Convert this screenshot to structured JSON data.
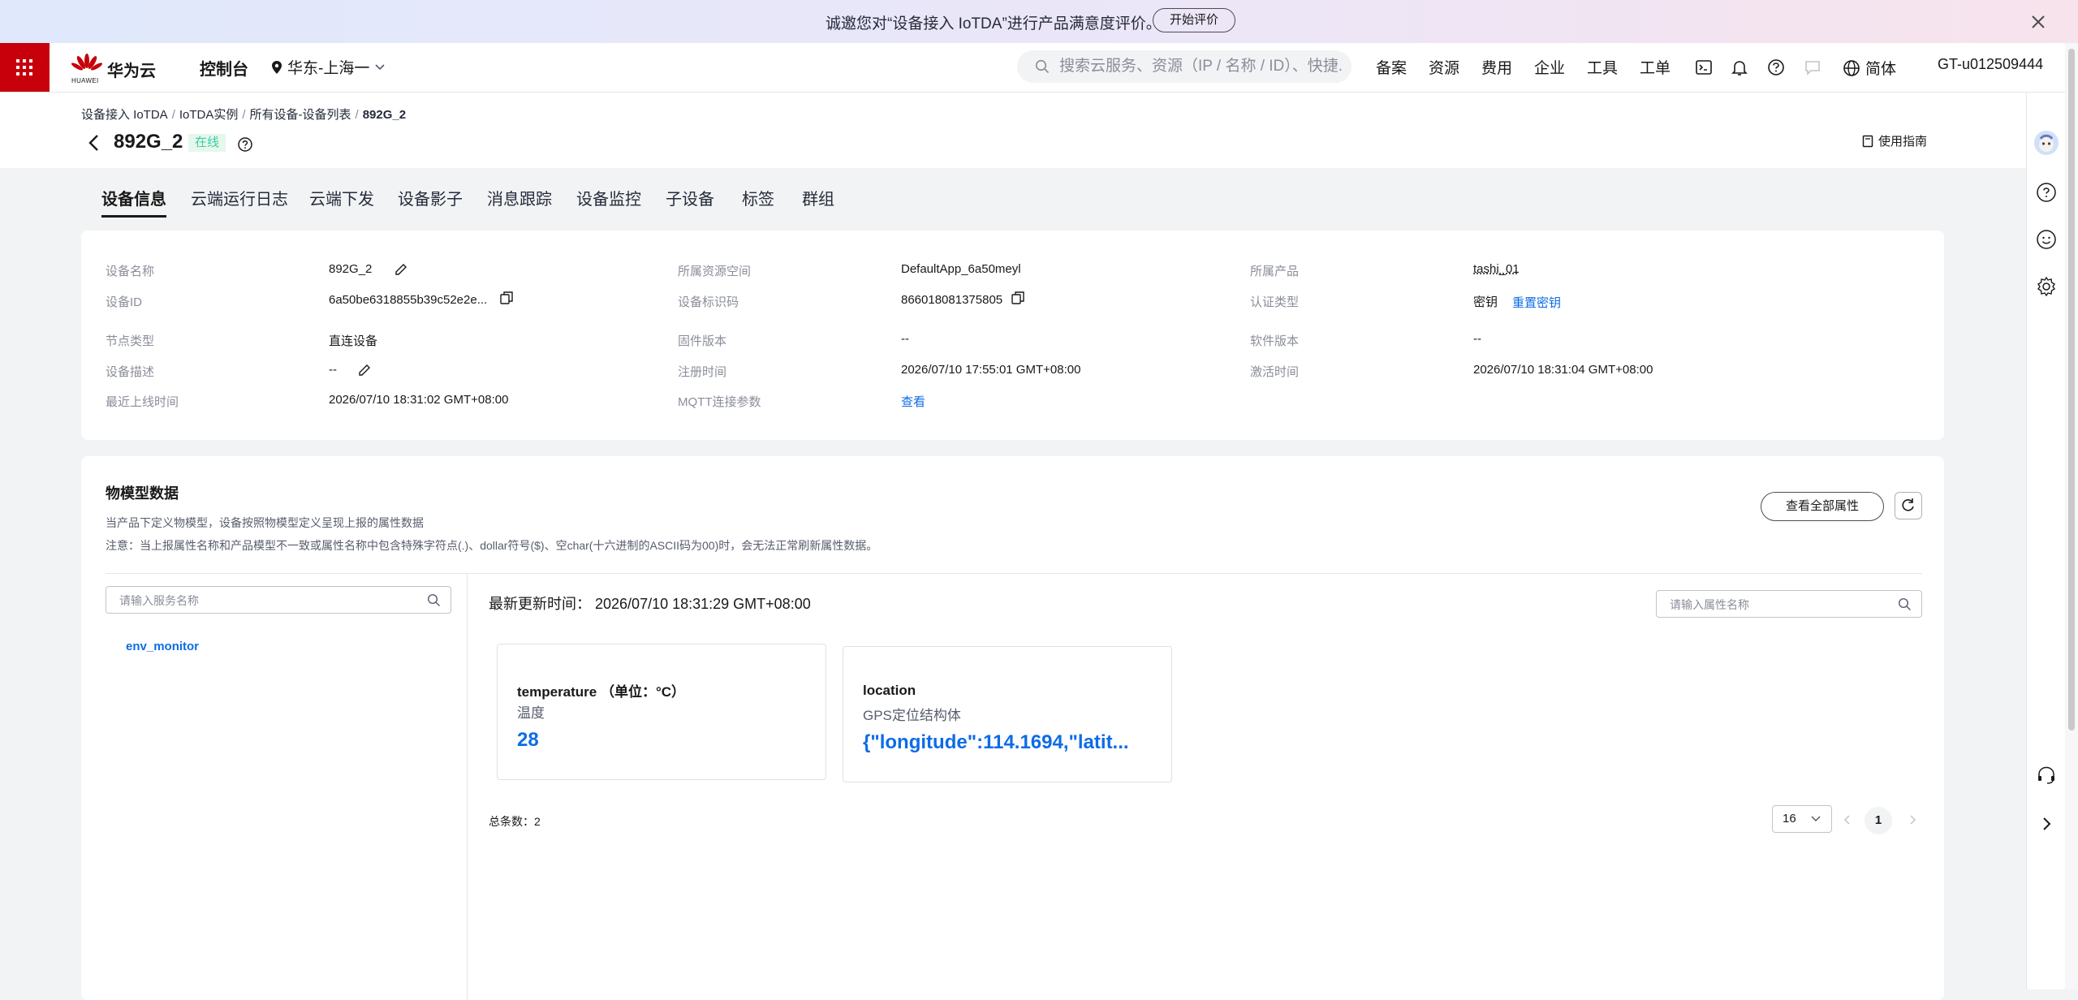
{
  "banner": {
    "text": "诚邀您对“设备接入 IoTDA”进行产品满意度评价。",
    "button": "开始评价"
  },
  "header": {
    "logo_name": "华为云",
    "logo_sub": "HUAWEI",
    "console": "控制台",
    "region": "华东-上海一",
    "search_placeholder": "搜索云服务、资源（IP / 名称 / ID）、快捷...",
    "nav": [
      "备案",
      "资源",
      "费用",
      "企业",
      "工具",
      "工单"
    ],
    "language": "简体",
    "account": "GT-u012509444"
  },
  "breadcrumb": [
    "设备接入 IoTDA",
    "IoTDA实例",
    "所有设备-设备列表",
    "892G_2"
  ],
  "device": {
    "name": "892G_2",
    "status": "在线"
  },
  "guide": "使用指南",
  "tabs": [
    "设备信息",
    "云端运行日志",
    "云端下发",
    "设备影子",
    "消息跟踪",
    "设备监控",
    "子设备",
    "标签",
    "群组"
  ],
  "info": {
    "device_name_label": "设备名称",
    "device_name": "892G_2",
    "device_id_label": "设备ID",
    "device_id": "6a50be6318855b39c52e2e...",
    "node_type_label": "节点类型",
    "node_type": "直连设备",
    "desc_label": "设备描述",
    "desc": "--",
    "last_online_label": "最近上线时间",
    "last_online": "2026/07/10 18:31:02 GMT+08:00",
    "space_label": "所属资源空间",
    "space": "DefaultApp_6a50meyl",
    "identifier_label": "设备标识码",
    "identifier": "866018081375805",
    "firmware_label": "固件版本",
    "firmware": "--",
    "register_label": "注册时间",
    "register": "2026/07/10 17:55:01 GMT+08:00",
    "mqtt_label": "MQTT连接参数",
    "mqtt": "查看",
    "product_label": "所属产品",
    "product": "tashi_01",
    "auth_label": "认证类型",
    "auth": "密钥",
    "reset_key": "重置密钥",
    "software_label": "软件版本",
    "software": "--",
    "activate_label": "激活时间",
    "activate": "2026/07/10 18:31:04 GMT+08:00"
  },
  "model": {
    "title": "物模型数据",
    "desc1": "当产品下定义物模型，设备按照物模型定义呈现上报的属性数据",
    "desc2": "注意：当上报属性名称和产品模型不一致或属性名称中包含特殊字符点(.)、dollar符号($)、空char(十六进制的ASCII码为00)时，会无法正常刷新属性数据。",
    "view_all": "查看全部属性",
    "service_search_placeholder": "请输入服务名称",
    "service": "env_monitor",
    "last_update_label": "最新更新时间：",
    "last_update": "2026/07/10 18:31:29 GMT+08:00",
    "prop_search_placeholder": "请输入属性名称",
    "properties": [
      {
        "name": "temperature （单位：°C）",
        "desc": "温度",
        "value": "28"
      },
      {
        "name": "location",
        "desc": "GPS定位结构体",
        "value": "{\"longitude\":114.1694,\"latit..."
      }
    ],
    "total_label": "总条数：",
    "total": "2",
    "page_size": "16",
    "page": "1"
  },
  "colors": {
    "brand_red": "#c7000b",
    "link_blue": "#0d6ce6",
    "online_green": "#3dcca6"
  }
}
